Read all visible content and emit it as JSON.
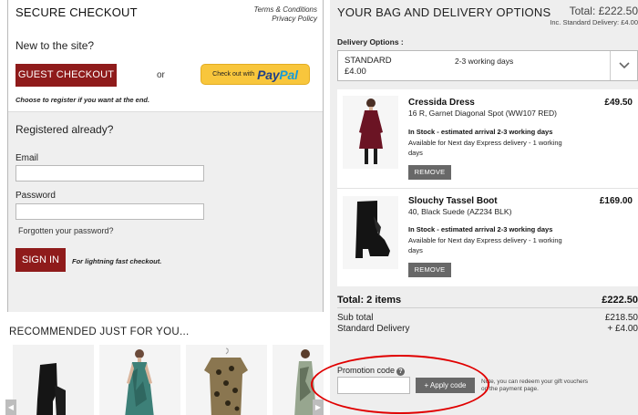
{
  "checkout": {
    "title": "SECURE CHECKOUT",
    "terms_link": "Terms & Conditions",
    "privacy_link": "Privacy Policy",
    "new_to_site": "New to the site?",
    "guest_button": "GUEST CHECKOUT",
    "or_text": "or",
    "paypal_prefix": "Check out with",
    "paypal_pay": "Pay",
    "paypal_pal": "Pal",
    "choose_register": "Choose to register if you want at the end.",
    "registered_title": "Registered already?",
    "email_label": "Email",
    "email_value": "",
    "password_label": "Password",
    "password_value": "",
    "forgot_link": "Forgotten your password?",
    "signin_button": "SIGN IN",
    "fast_checkout": "For lightning fast checkout."
  },
  "recommended": {
    "title": "RECOMMENDED JUST FOR YOU...",
    "items": [
      {
        "icon": "black-boot-image"
      },
      {
        "icon": "patterned-dress-image"
      },
      {
        "icon": "leopard-top-image"
      },
      {
        "icon": "printed-dress-image"
      }
    ]
  },
  "bag": {
    "title": "YOUR BAG AND DELIVERY OPTIONS",
    "total": "Total: £222.50",
    "inc_delivery": "Inc. Standard Delivery: £4.00",
    "delivery_label": "Delivery Options :",
    "delivery_selected_name": "STANDARD",
    "delivery_selected_price": "£4.00",
    "delivery_selected_days": "2-3 working days",
    "items": [
      {
        "name": "Cressida Dress",
        "variant": "16 R, Garnet Diagonal Spot (WW107 RED)",
        "stock": "In Stock - estimated arrival 2-3 working days",
        "availability": "Available for Next day Express delivery - 1 working days",
        "price": "£49.50",
        "remove_label": "REMOVE"
      },
      {
        "name": "Slouchy Tassel Boot",
        "variant": "40, Black Suede (AZ234 BLK)",
        "stock": "In Stock - estimated arrival 2-3 working days",
        "availability": "Available for Next day Express delivery - 1 working days",
        "price": "£169.00",
        "remove_label": "REMOVE"
      }
    ],
    "total_items_label": "Total: 2 items",
    "total_items_price": "£222.50",
    "subtotal_label": "Sub total",
    "subtotal_value": "£218.50",
    "std_delivery_label": "Standard Delivery",
    "std_delivery_value": "+ £4.00",
    "promo_label": "Promotion code",
    "promo_value": "",
    "apply_button": "+ Apply code",
    "promo_note": "Note, you can redeem your gift vouchers on the payment page."
  },
  "colors": {
    "accent_red": "#8f1b1b",
    "paypal_yellow": "#f8c63c",
    "highlight_ellipse": "#e00000"
  }
}
